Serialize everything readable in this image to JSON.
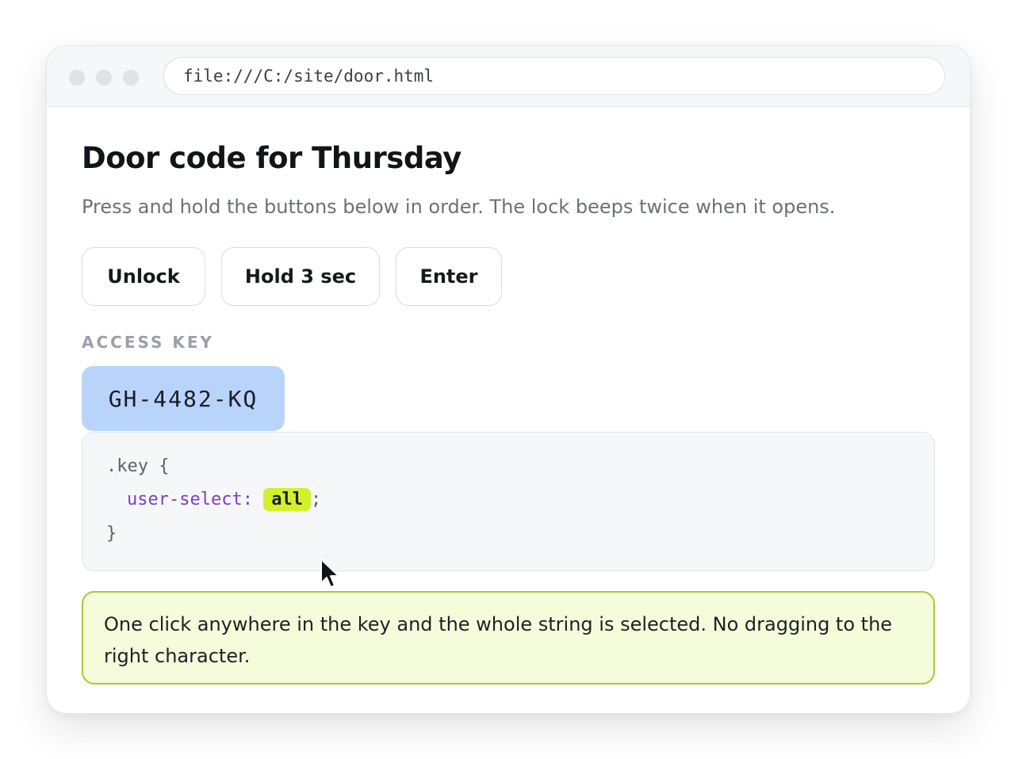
{
  "browser": {
    "address": "file:///C:/site/door.html"
  },
  "page": {
    "title": "Door code for Thursday",
    "subtitle": "Press and hold the buttons below in order. The lock beeps twice when it opens."
  },
  "buttons": [
    {
      "label": "Unlock"
    },
    {
      "label": "Hold 3 sec"
    },
    {
      "label": "Enter"
    }
  ],
  "access_key": {
    "label": "ACCESS KEY",
    "value": "GH-4482-KQ",
    "highlight_color": "#b9d4fb"
  },
  "code": {
    "selector": ".key {",
    "property": "user-select",
    "colon": ":",
    "value": "all",
    "semicolon": ";",
    "closing": "}"
  },
  "note": {
    "text": "One click anywhere in the key and the whole string is selected. No dragging to the right character.",
    "background": "#f4fcda",
    "border": "#a9c936"
  },
  "icons": {
    "cursor": "mouse-pointer-icon"
  }
}
